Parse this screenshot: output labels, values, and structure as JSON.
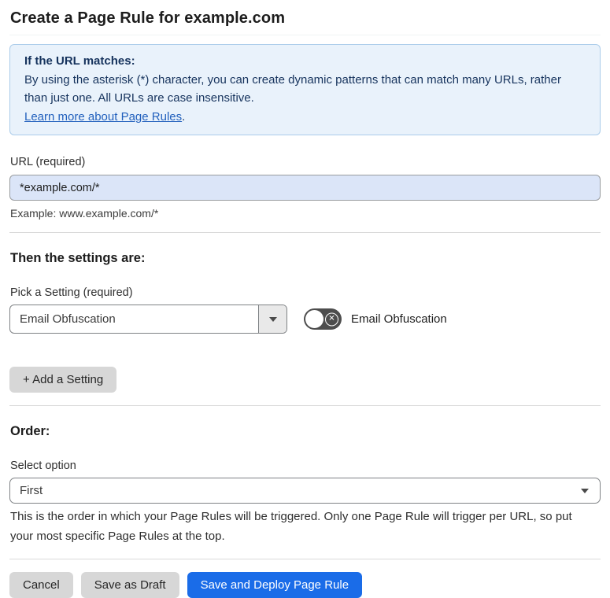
{
  "page": {
    "title": "Create a Page Rule for example.com"
  },
  "info_box": {
    "heading": "If the URL matches:",
    "body": "By using the asterisk (*) character, you can create dynamic patterns that can match many URLs, rather than just one. All URLs are case insensitive.",
    "link_label": "Learn more about Page Rules",
    "link_suffix": "."
  },
  "url_section": {
    "label": "URL (required)",
    "value": "*example.com/*",
    "example": "Example: www.example.com/*"
  },
  "settings_section": {
    "heading": "Then the settings are:",
    "picker_label": "Pick a Setting (required)",
    "picker_value": "Email Obfuscation",
    "toggle_label": "Email Obfuscation",
    "toggle_state": "off",
    "toggle_icon": "✕",
    "add_button_label": "+ Add a Setting"
  },
  "order_section": {
    "heading": "Order:",
    "select_label": "Select option",
    "select_value": "First",
    "help_text": "This is the order in which your Page Rules will be triggered. Only one Page Rule will trigger per URL, so put your most specific Page Rules at the top."
  },
  "footer": {
    "cancel_label": "Cancel",
    "save_draft_label": "Save as Draft",
    "save_deploy_label": "Save and Deploy Page Rule"
  },
  "colors": {
    "accent_blue": "#1a6ce8",
    "info_bg": "#e9f2fb",
    "info_border": "#abccea",
    "info_text": "#16335d",
    "link_blue": "#2160bd",
    "input_bg": "#dbe5f8",
    "toggle_bg": "#4d4d4d",
    "gray_btn": "#d7d7d7",
    "divider": "#d9d9d9"
  }
}
